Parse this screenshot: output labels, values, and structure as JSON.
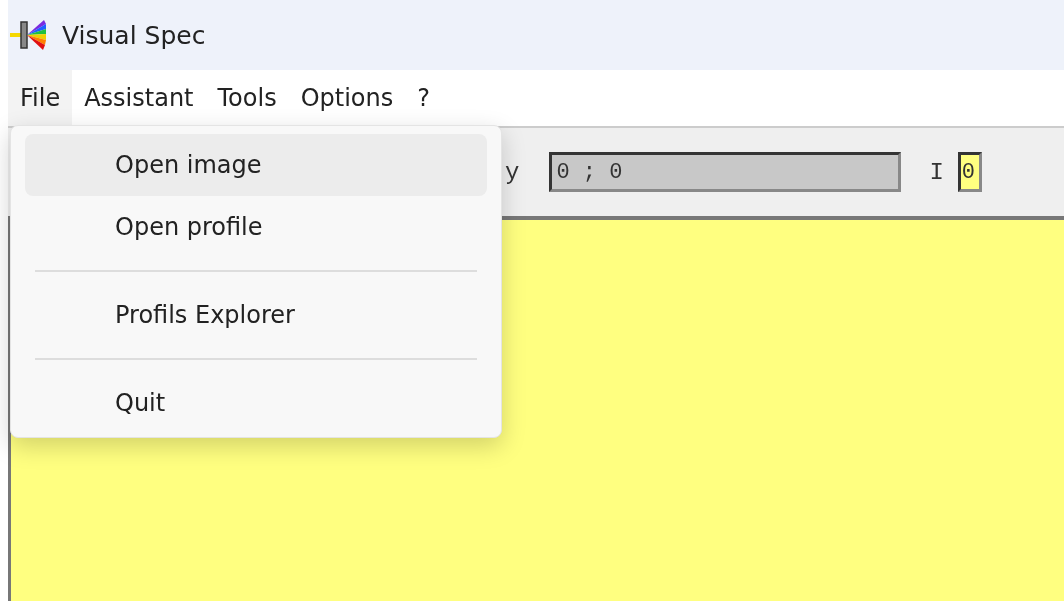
{
  "window": {
    "title": "Visual Spec"
  },
  "menubar": [
    {
      "label": "File",
      "selected": true
    },
    {
      "label": "Assistant",
      "selected": false
    },
    {
      "label": "Tools",
      "selected": false
    },
    {
      "label": "Options",
      "selected": false
    },
    {
      "label": "?",
      "selected": false
    }
  ],
  "toolbar": {
    "coord_label": "y",
    "coord_value": "0 ; 0",
    "intensity_label": "I",
    "intensity_value": "0"
  },
  "file_menu": [
    {
      "kind": "item",
      "label": "Open image",
      "selected": true
    },
    {
      "kind": "item",
      "label": "Open profile",
      "selected": false
    },
    {
      "kind": "separator"
    },
    {
      "kind": "item",
      "label": "Profils Explorer",
      "selected": false
    },
    {
      "kind": "separator"
    },
    {
      "kind": "item",
      "label": "Quit",
      "selected": false
    }
  ]
}
